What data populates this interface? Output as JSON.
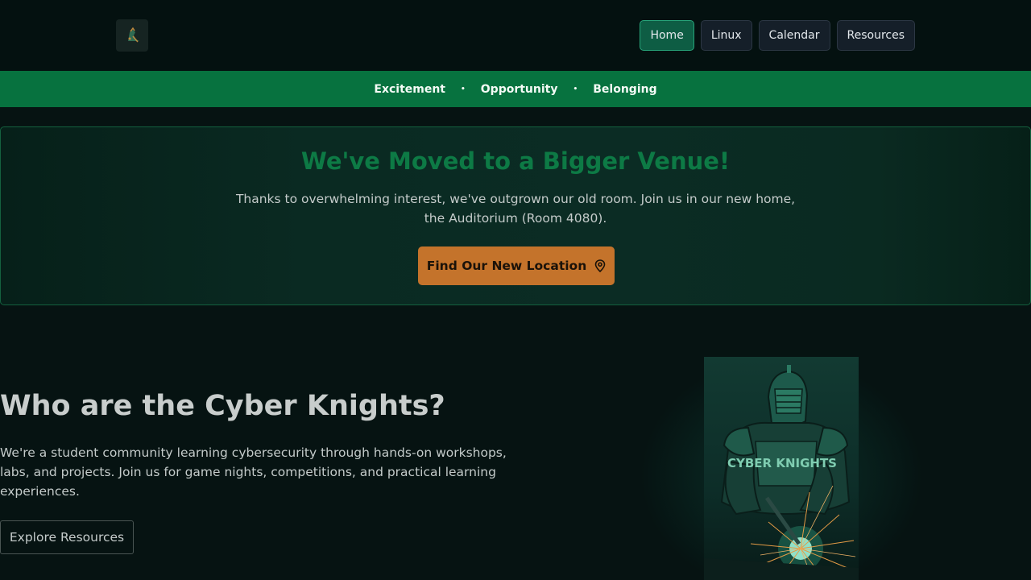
{
  "nav": {
    "items": [
      {
        "label": "Home",
        "active": true
      },
      {
        "label": "Linux",
        "active": false
      },
      {
        "label": "Calendar",
        "active": false
      },
      {
        "label": "Resources",
        "active": false
      }
    ]
  },
  "values": {
    "items": [
      "Excitement",
      "Opportunity",
      "Belonging"
    ],
    "separator": "•"
  },
  "announcement": {
    "title": "We've Moved to a Bigger Venue!",
    "body": "Thanks to overwhelming interest, we've outgrown our old room. Join us in our new home, the Auditorium (Room 4080).",
    "cta_label": "Find Our New Location",
    "cta_icon": "location-pin-icon"
  },
  "about": {
    "title": "Who are the Cyber Knights?",
    "body": "We're a student community learning cybersecurity through hands-on workshops, labs, and projects. Join us for game nights, competitions, and practical learning experiences.",
    "button_label": "Explore Resources"
  },
  "poster": {
    "text": "CYBER KNIGHTS"
  },
  "colors": {
    "accent_green": "#07723f",
    "title_green": "#0d7a45",
    "cta_orange": "#c4732b",
    "background": "#061312"
  }
}
